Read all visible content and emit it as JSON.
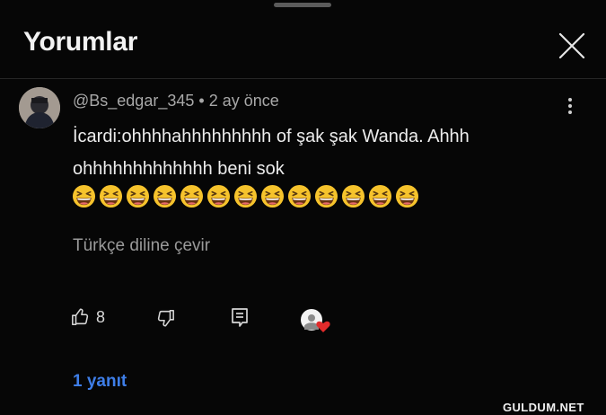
{
  "header": {
    "title": "Yorumlar"
  },
  "comment": {
    "author": "@Bs_edgar_345",
    "separator": "•",
    "timestamp": "2 ay önce",
    "text": "İcardi:ohhhhahhhhhhhhh of şak şak Wanda. Ahhh ohhhhhhhhhhhhh beni sok",
    "emoji_count": 13,
    "emoji_name": "grinning-squinting-face",
    "translate_label": "Türkçe diline çevir",
    "like_count": "8",
    "replies_label": "1 yanıt"
  },
  "watermark": "GULDUM.NET",
  "colors": {
    "background": "#060606",
    "link_blue": "#3e7ee8",
    "heart_red": "#e22b2b"
  }
}
